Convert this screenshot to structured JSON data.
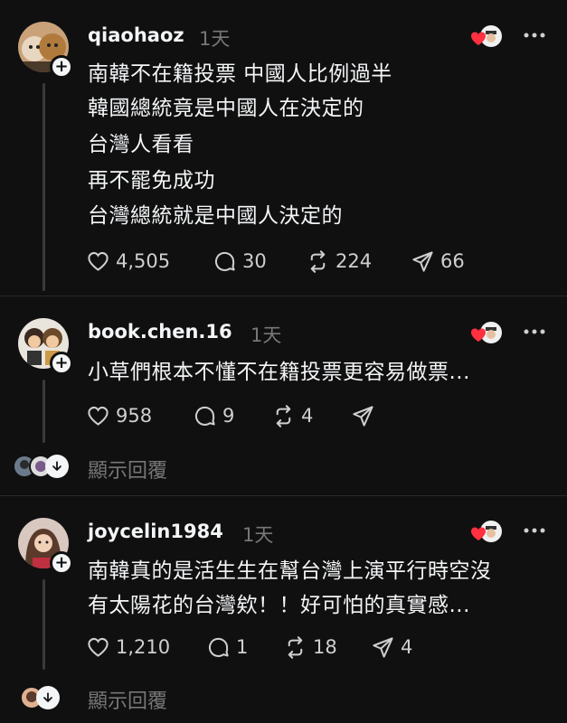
{
  "posts": [
    {
      "username": "qiaohaoz",
      "time": "1天",
      "lines": [
        "南韓不在籍投票  中國人比例過半",
        "韓國總統竟是中國人在決定的",
        "台灣人看看",
        "再不罷免成功",
        "台灣總統就是中國人決定的"
      ],
      "likes": "4,505",
      "replies": "30",
      "reposts": "224",
      "shares": "66"
    },
    {
      "username": "book.chen.16",
      "time": "1天",
      "lines": [
        "小草們根本不懂不在籍投票更容易做票..."
      ],
      "likes": "958",
      "replies": "9",
      "reposts": "4",
      "shares": "",
      "show_replies": "顯示回覆"
    },
    {
      "username": "joycelin1984",
      "time": "1天",
      "lines": [
        "南韓真的是活生生在幫台灣上演平行時空沒",
        "有太陽花的台灣欸！！好可怕的真實感..."
      ],
      "likes": "1,210",
      "replies": "1",
      "reposts": "18",
      "shares": "4",
      "show_replies": "顯示回覆"
    }
  ],
  "colors": {
    "background": "#101010",
    "text": "#f3f5f7",
    "muted": "#777777",
    "heart": "#ff3040"
  },
  "icons": [
    "heart-icon",
    "comment-icon",
    "repost-icon",
    "share-icon",
    "more-icon",
    "follow-plus-icon",
    "chevron-down-icon"
  ]
}
